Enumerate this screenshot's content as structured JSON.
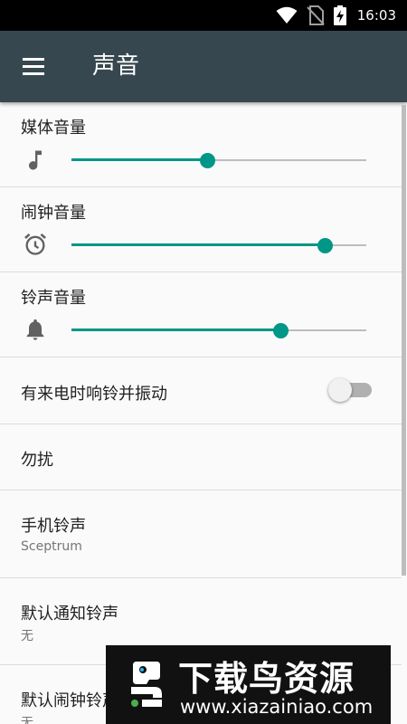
{
  "status_bar": {
    "time": "16:03",
    "icons": [
      "wifi-icon",
      "no-sim-icon",
      "battery-charging-icon"
    ]
  },
  "app_bar": {
    "title": "声音",
    "menu_icon": "hamburger-menu-icon"
  },
  "sliders": [
    {
      "label": "媒体音量",
      "icon": "music-note-icon",
      "level_percent": 46
    },
    {
      "label": "闹钟音量",
      "icon": "alarm-clock-icon",
      "level_percent": 86
    },
    {
      "label": "铃声音量",
      "icon": "bell-icon",
      "level_percent": 71
    }
  ],
  "vibrate_setting": {
    "label": "有来电时响铃并振动",
    "enabled": false
  },
  "list_items": [
    {
      "label": "勿扰",
      "value": ""
    },
    {
      "label": "手机铃声",
      "value": "Sceptrum"
    },
    {
      "label": "默认通知铃声",
      "value": "无"
    },
    {
      "label": "默认闹钟铃声",
      "value": "无"
    }
  ],
  "watermark": {
    "title": "下载鸟资源",
    "url": "www.xiazainiao.com"
  },
  "colors": {
    "accent": "#009688",
    "app_bar": "#37474f",
    "status_bar": "#000000",
    "background": "#fafafa"
  }
}
